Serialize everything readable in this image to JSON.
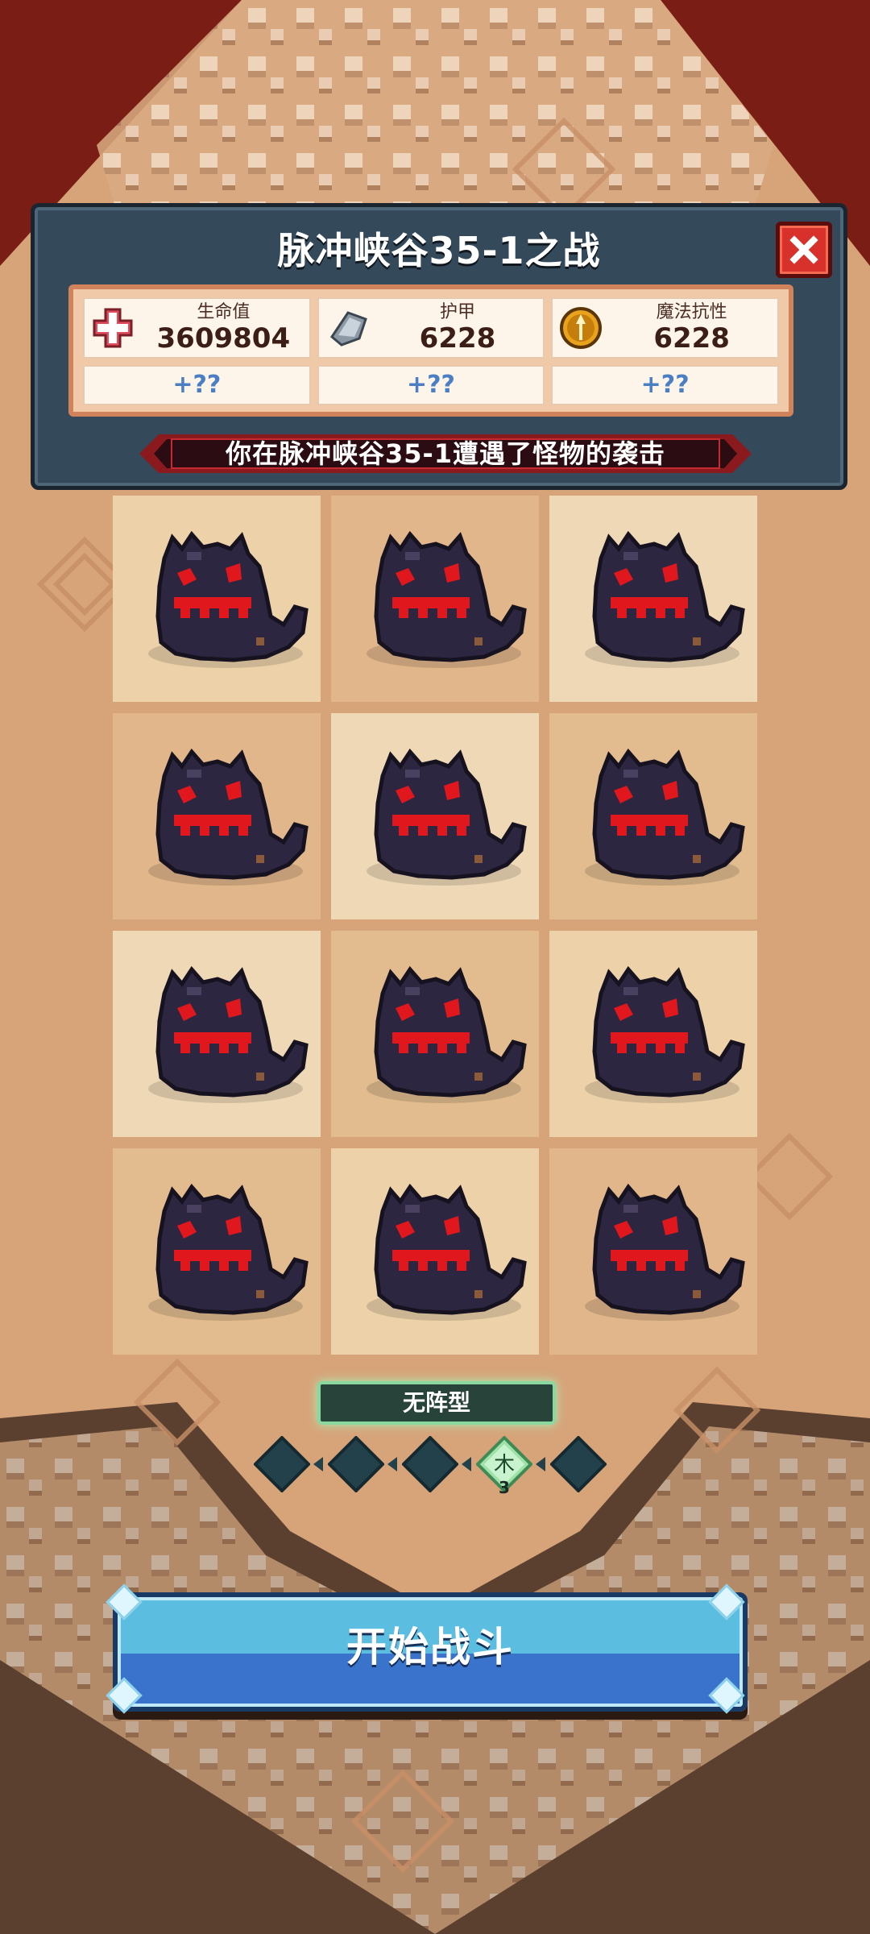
{
  "battle": {
    "title": "脉冲峡谷35-1之战",
    "encounter_message": "你在脉冲峡谷35-1遭遇了怪物的袭击"
  },
  "stats": [
    {
      "label": "生命值",
      "value": "3609804",
      "bonus": "+??",
      "icon": "health-cross-icon"
    },
    {
      "label": "护甲",
      "value": "6228",
      "bonus": "+??",
      "icon": "armor-shard-icon"
    },
    {
      "label": "魔法抗性",
      "value": "6228",
      "bonus": "+??",
      "icon": "magic-resist-icon"
    }
  ],
  "monsters": {
    "count": 12,
    "type": "shadow-ghost",
    "cells": [
      {
        "row": 1,
        "col": 1
      },
      {
        "row": 1,
        "col": 2
      },
      {
        "row": 1,
        "col": 3
      },
      {
        "row": 2,
        "col": 1
      },
      {
        "row": 2,
        "col": 2
      },
      {
        "row": 2,
        "col": 3
      },
      {
        "row": 3,
        "col": 1
      },
      {
        "row": 3,
        "col": 2
      },
      {
        "row": 3,
        "col": 3
      },
      {
        "row": 4,
        "col": 1
      },
      {
        "row": 4,
        "col": 2
      },
      {
        "row": 4,
        "col": 3
      }
    ]
  },
  "formation": {
    "label": "无阵型",
    "active_element": "木",
    "active_count": "3",
    "slots": 5,
    "active_slot": 4
  },
  "start_button": {
    "label": "开始战斗"
  },
  "colors": {
    "panel": "#34495a",
    "stats_box": "#f0c9a8",
    "bonus_text": "#4a7fc4",
    "close_button": "#d8302a",
    "start_top": "#5bbde0",
    "start_bottom": "#3a73cc",
    "monster_body": "#2c2640",
    "monster_eyes": "#e0181e"
  }
}
